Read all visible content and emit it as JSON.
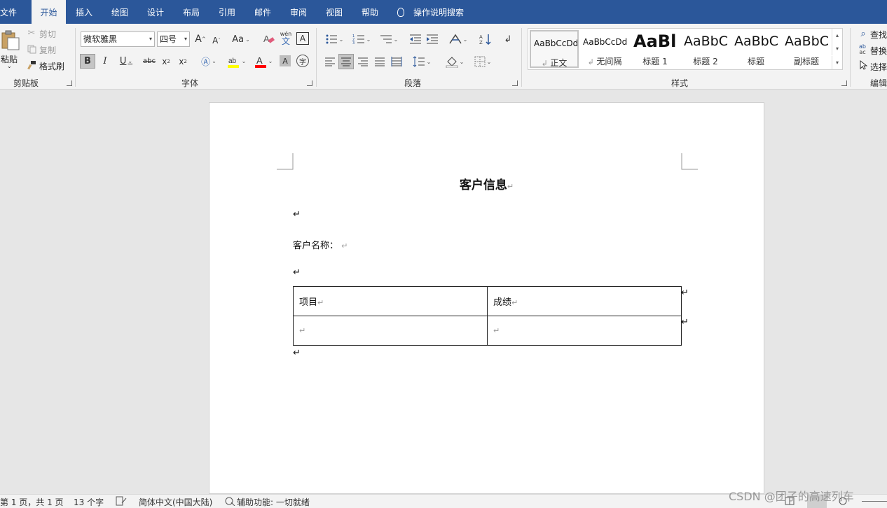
{
  "menu": {
    "tabs": [
      "文件",
      "开始",
      "插入",
      "绘图",
      "设计",
      "布局",
      "引用",
      "邮件",
      "审阅",
      "视图",
      "帮助"
    ],
    "active_tab": "开始",
    "tell_me": "操作说明搜索"
  },
  "ribbon": {
    "clipboard": {
      "paste": "粘贴",
      "cut": "剪切",
      "copy": "复制",
      "format_painter": "格式刷",
      "label": "剪贴板"
    },
    "font": {
      "font_name": "微软雅黑",
      "font_size": "四号",
      "label": "字体",
      "wen_glyph": "wén",
      "wen_char": "文"
    },
    "paragraph": {
      "label": "段落"
    },
    "styles": {
      "label": "样式",
      "items": [
        {
          "preview": "AaBbCcDd",
          "name": "正文"
        },
        {
          "preview": "AaBbCcDd",
          "name": "无间隔"
        },
        {
          "preview": "AaBl",
          "name": "标题 1"
        },
        {
          "preview": "AaBbC",
          "name": "标题 2"
        },
        {
          "preview": "AaBbC",
          "name": "标题"
        },
        {
          "preview": "AaBbC",
          "name": "副标题"
        }
      ]
    },
    "editing": {
      "find": "查找",
      "replace": "替换",
      "select": "选择",
      "label": "编辑"
    }
  },
  "document": {
    "title": "客户信息",
    "customer_label": "客户名称：",
    "table": {
      "headers": [
        "项目",
        "成绩"
      ],
      "rows": [
        [
          "",
          ""
        ]
      ]
    },
    "para_mark": "↵"
  },
  "status": {
    "page": "第 1 页，共 1 页",
    "words": "13 个字",
    "language": "简体中文(中国大陆)",
    "accessibility": "辅助功能: 一切就绪"
  },
  "watermark": "CSDN @团子的高速列车",
  "colors": {
    "brand": "#2b579a",
    "highlight": "#ffff00",
    "font_color": "#ff0000"
  }
}
